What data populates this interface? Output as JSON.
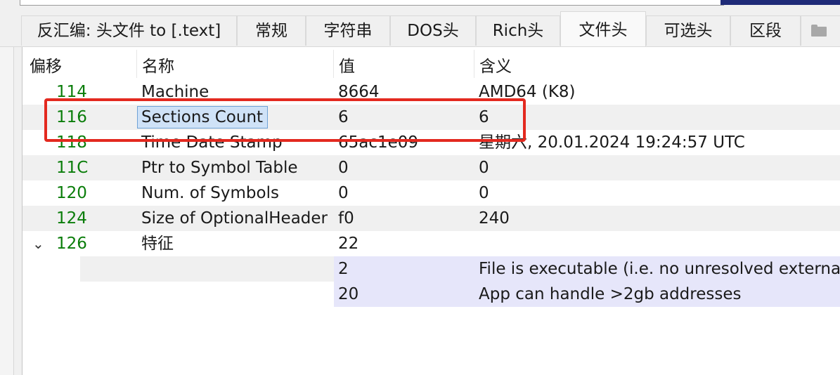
{
  "tabs": [
    {
      "label": "反汇编: 头文件 to [.text]"
    },
    {
      "label": "常规"
    },
    {
      "label": "字符串"
    },
    {
      "label": "DOS头"
    },
    {
      "label": "Rich头"
    },
    {
      "label": "文件头",
      "active": true
    },
    {
      "label": "可选头"
    },
    {
      "label": "区段"
    }
  ],
  "tab_overflow_icon": "folder-icon",
  "table": {
    "headers": {
      "offset": "偏移",
      "name": "名称",
      "value": "值",
      "meaning": "含义"
    },
    "rows": [
      {
        "offset": "114",
        "name": "Machine",
        "value": "8664",
        "meaning": "AMD64 (K8)"
      },
      {
        "offset": "116",
        "name": "Sections Count",
        "value": "6",
        "meaning": "6",
        "selected": true
      },
      {
        "offset": "118",
        "name": "Time Date Stamp",
        "value": "65ac1e09",
        "meaning": "星期六, 20.01.2024 19:24:57 UTC"
      },
      {
        "offset": "11C",
        "name": "Ptr to Symbol Table",
        "value": "0",
        "meaning": "0"
      },
      {
        "offset": "120",
        "name": "Num. of Symbols",
        "value": "0",
        "meaning": "0"
      },
      {
        "offset": "124",
        "name": "Size of OptionalHeader",
        "value": "f0",
        "meaning": "240"
      },
      {
        "offset": "126",
        "name": "特征",
        "value": "22",
        "meaning": "",
        "expanded": true
      }
    ],
    "characteristics_flags": [
      {
        "value": "2",
        "meaning": "File is executable  (i.e. no unresolved external"
      },
      {
        "value": "20",
        "meaning": "App can handle >2gb addresses"
      }
    ]
  },
  "colors": {
    "offset_text": "#0a7d0a",
    "highlight_box": "#e3291f",
    "selection": "#cfe2f7",
    "flag_row": "#e6e6fa"
  }
}
